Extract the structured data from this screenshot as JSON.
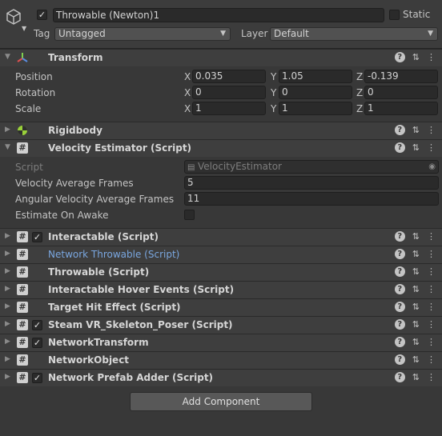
{
  "header": {
    "object_name": "Throwable (Newton)1",
    "active_checked": true,
    "static_label": "Static",
    "tag_label": "Tag",
    "tag_value": "Untagged",
    "layer_label": "Layer",
    "layer_value": "Default"
  },
  "transform": {
    "title": "Transform",
    "rows": [
      {
        "label": "Position",
        "x": "0.035",
        "y": "1.05",
        "z": "-0.139"
      },
      {
        "label": "Rotation",
        "x": "0",
        "y": "0",
        "z": "0"
      },
      {
        "label": "Scale",
        "x": "1",
        "y": "1",
        "z": "1"
      }
    ],
    "axis_x": "X",
    "axis_y": "Y",
    "axis_z": "Z"
  },
  "rigidbody": {
    "title": "Rigidbody"
  },
  "velocity_estimator": {
    "title": "Velocity Estimator (Script)",
    "script_label": "Script",
    "script_value": "VelocityEstimator",
    "vel_avg_label": "Velocity Average Frames",
    "vel_avg_value": "5",
    "ang_avg_label": "Angular Velocity Average Frames",
    "ang_avg_value": "11",
    "estimate_label": "Estimate On Awake",
    "estimate_checked": false
  },
  "components": [
    {
      "title": "Interactable (Script)",
      "checkbox": true
    },
    {
      "title": "Network Throwable (Script)",
      "checkbox": false
    },
    {
      "title": "Throwable (Script)",
      "checkbox": false
    },
    {
      "title": "Interactable Hover Events (Script)",
      "checkbox": false
    },
    {
      "title": "Target Hit Effect (Script)",
      "checkbox": false
    },
    {
      "title": "Steam VR_Skeleton_Poser (Script)",
      "checkbox": true
    },
    {
      "title": "NetworkTransform",
      "checkbox": true
    },
    {
      "title": "NetworkObject",
      "checkbox": false
    },
    {
      "title": "Network Prefab Adder (Script)",
      "checkbox": true
    }
  ],
  "add_component_label": "Add Component",
  "colors": {
    "background": "#383838",
    "header": "#3e3e3e",
    "link_blue": "#7aa7e0"
  },
  "icons": [
    "gameobject-cube-icon",
    "transform-axes-icon",
    "rigidbody-icon",
    "script-hash-icon",
    "help-icon",
    "settings-sliders-icon",
    "more-vertical-icon"
  ]
}
